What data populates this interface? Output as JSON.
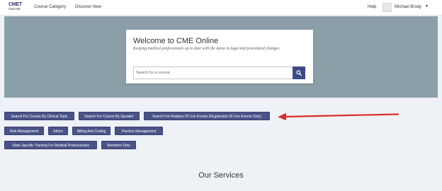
{
  "header": {
    "logo_line1": "CMET",
    "logo_line2": "ONLINE",
    "nav": [
      "Course Category",
      "Discover New"
    ],
    "help": "Help",
    "user_name": "Michael Brody",
    "caret": "▼"
  },
  "hero": {
    "title": "Welcome to CME Online",
    "subtitle": "Keeping medical professionals up to date with the latest in legal and procedural changes.",
    "search_placeholder": "Search for a course"
  },
  "buttons": [
    "Search For Course By Clinical Topic",
    "Search For Course By Speaker",
    "Search For Replays Of Live Events (Registrants Of Live Events Only)",
    "Risk Management",
    "Ethics",
    "Billing And Coding",
    "Practice Management",
    "State Specific Training For Medical Professionals",
    "Members Only"
  ],
  "services_title": "Our Services",
  "colors": {
    "accent": "#4a5388",
    "hero_bg": "#8a9fa8",
    "arrow": "#d9302a"
  },
  "icons": [
    "search-icon",
    "user-avatar-icon",
    "caret-down-icon",
    "arrow-left-icon"
  ]
}
